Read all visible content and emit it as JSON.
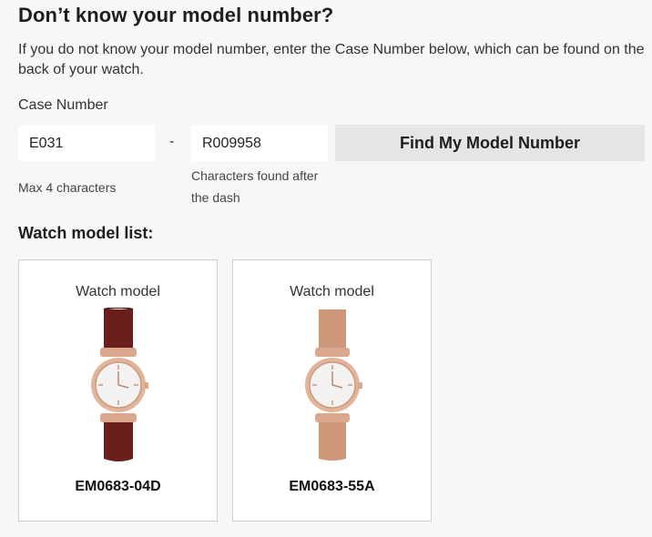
{
  "page": {
    "heading": "Don’t know your model number?",
    "intro": "If you do not know your model number, enter the Case Number below, which can be found on the back of your watch."
  },
  "form": {
    "case_label": "Case Number",
    "field1_value": "E031",
    "separator": "-",
    "field2_value": "R009958",
    "button_label": "Find My Model Number",
    "hint1": "Max 4 characters",
    "hint2": "Characters found after the dash"
  },
  "list": {
    "title": "Watch model list:",
    "items": [
      {
        "category": "Watch model",
        "model": "EM0683-04D",
        "strap": "leather",
        "strap_color": "#6b1f1c",
        "case_color": "#e3b49a"
      },
      {
        "category": "Watch model",
        "model": "EM0683-55A",
        "strap": "mesh",
        "strap_color": "#d9a385",
        "case_color": "#e3b49a"
      }
    ]
  },
  "colors": {
    "background": "#f6f7f8",
    "button_bg": "#e5e5e5",
    "field_bg": "#ffffff"
  }
}
